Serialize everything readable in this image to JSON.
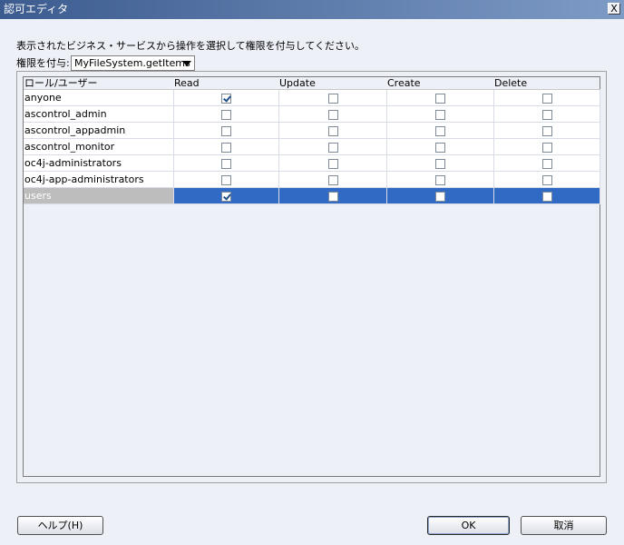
{
  "window": {
    "title": "認可エディタ",
    "close_glyph": "X"
  },
  "instruction": "表示されたビジネス・サービスから操作を選択して権限を付与してください。",
  "permission": {
    "label": "権限を付与:",
    "selected_method": "MyFileSystem.getItems"
  },
  "table": {
    "columns": [
      "ロール/ユーザー",
      "Read",
      "Update",
      "Create",
      "Delete"
    ],
    "rows": [
      {
        "role": "anyone",
        "read": true,
        "update": false,
        "create": false,
        "delete": false,
        "selected": false
      },
      {
        "role": "ascontrol_admin",
        "read": false,
        "update": false,
        "create": false,
        "delete": false,
        "selected": false
      },
      {
        "role": "ascontrol_appadmin",
        "read": false,
        "update": false,
        "create": false,
        "delete": false,
        "selected": false
      },
      {
        "role": "ascontrol_monitor",
        "read": false,
        "update": false,
        "create": false,
        "delete": false,
        "selected": false
      },
      {
        "role": "oc4j-administrators",
        "read": false,
        "update": false,
        "create": false,
        "delete": false,
        "selected": false
      },
      {
        "role": "oc4j-app-administrators",
        "read": false,
        "update": false,
        "create": false,
        "delete": false,
        "selected": false
      },
      {
        "role": "users",
        "read": true,
        "update": false,
        "create": false,
        "delete": false,
        "selected": true
      }
    ]
  },
  "buttons": {
    "help": "ヘルプ(H)",
    "ok": "OK",
    "cancel": "取消"
  },
  "colors": {
    "title_bar": "#3c5b8f",
    "selection": "#316ac5",
    "dialog_bg": "#eef0f7"
  }
}
